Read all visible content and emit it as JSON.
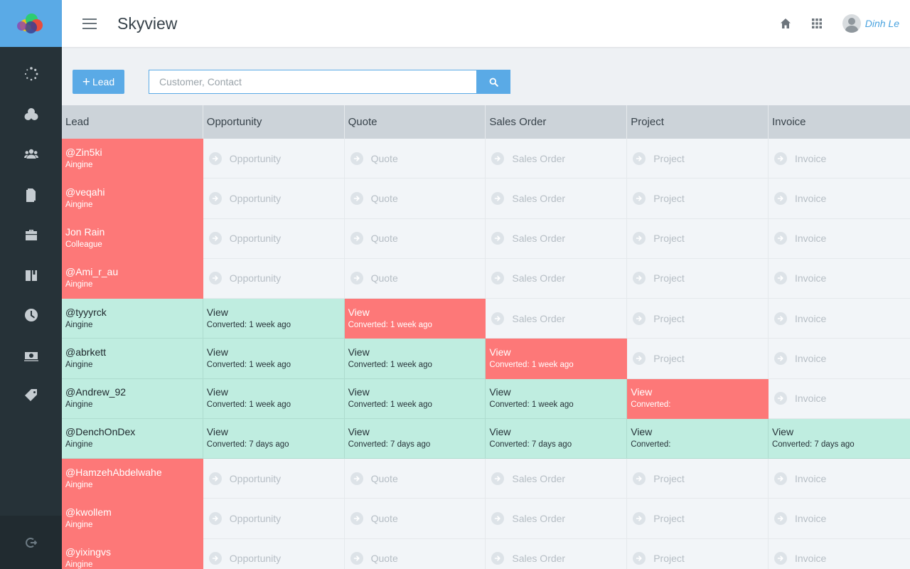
{
  "app": {
    "title": "Skyview"
  },
  "header": {
    "user_name": "Dinh Le"
  },
  "toolbar": {
    "lead_button_label": "Lead",
    "search_placeholder": "Customer, Contact"
  },
  "table": {
    "columns": [
      "Lead",
      "Opportunity",
      "Quote",
      "Sales Order",
      "Project",
      "Invoice"
    ],
    "rows": [
      {
        "lead": {
          "name": "@Zin5ki",
          "company": "Aingine"
        },
        "stages": [
          {
            "label": "Opportunity"
          },
          {
            "label": "Quote"
          },
          {
            "label": "Sales Order"
          },
          {
            "label": "Project"
          },
          {
            "label": "Invoice"
          }
        ]
      },
      {
        "lead": {
          "name": "@veqahi",
          "company": "Aingine"
        },
        "stages": [
          {
            "label": "Opportunity"
          },
          {
            "label": "Quote"
          },
          {
            "label": "Sales Order"
          },
          {
            "label": "Project"
          },
          {
            "label": "Invoice"
          }
        ]
      },
      {
        "lead": {
          "name": "Jon Rain",
          "company": "Colleague"
        },
        "stages": [
          {
            "label": "Opportunity"
          },
          {
            "label": "Quote"
          },
          {
            "label": "Sales Order"
          },
          {
            "label": "Project"
          },
          {
            "label": "Invoice"
          }
        ]
      },
      {
        "lead": {
          "name": "@Ami_r_au",
          "company": "Aingine"
        },
        "stages": [
          {
            "label": "Opportunity"
          },
          {
            "label": "Quote"
          },
          {
            "label": "Sales Order"
          },
          {
            "label": "Project"
          },
          {
            "label": "Invoice"
          }
        ]
      },
      {
        "lead": {
          "name": "@tyyyrck",
          "company": "Aingine"
        },
        "stages": [
          {
            "view": "View",
            "converted": "Converted: 1 week ago"
          },
          {
            "view": "View",
            "converted": "Converted: 1 week ago",
            "current": true
          },
          {
            "label": "Sales Order"
          },
          {
            "label": "Project"
          },
          {
            "label": "Invoice"
          }
        ]
      },
      {
        "lead": {
          "name": "@abrkett",
          "company": "Aingine"
        },
        "stages": [
          {
            "view": "View",
            "converted": "Converted: 1 week ago"
          },
          {
            "view": "View",
            "converted": "Converted: 1 week ago"
          },
          {
            "view": "View",
            "converted": "Converted: 1 week ago",
            "current": true
          },
          {
            "label": "Project"
          },
          {
            "label": "Invoice"
          }
        ]
      },
      {
        "lead": {
          "name": "@Andrew_92",
          "company": "Aingine"
        },
        "stages": [
          {
            "view": "View",
            "converted": "Converted: 1 week ago"
          },
          {
            "view": "View",
            "converted": "Converted: 1 week ago"
          },
          {
            "view": "View",
            "converted": "Converted: 1 week ago"
          },
          {
            "view": "View",
            "converted": "Converted:",
            "current": true
          },
          {
            "label": "Invoice"
          }
        ]
      },
      {
        "lead": {
          "name": "@DenchOnDex",
          "company": "Aingine"
        },
        "stages": [
          {
            "view": "View",
            "converted": "Converted: 7 days ago"
          },
          {
            "view": "View",
            "converted": "Converted: 7 days ago"
          },
          {
            "view": "View",
            "converted": "Converted: 7 days ago"
          },
          {
            "view": "View",
            "converted": "Converted:"
          },
          {
            "view": "View",
            "converted": "Converted: 7 days ago"
          }
        ]
      },
      {
        "lead": {
          "name": "@HamzehAbdelwahe",
          "company": "Aingine"
        },
        "stages": [
          {
            "label": "Opportunity"
          },
          {
            "label": "Quote"
          },
          {
            "label": "Sales Order"
          },
          {
            "label": "Project"
          },
          {
            "label": "Invoice"
          }
        ]
      },
      {
        "lead": {
          "name": "@kwollem",
          "company": "Aingine"
        },
        "stages": [
          {
            "label": "Opportunity"
          },
          {
            "label": "Quote"
          },
          {
            "label": "Sales Order"
          },
          {
            "label": "Project"
          },
          {
            "label": "Invoice"
          }
        ]
      },
      {
        "lead": {
          "name": "@yixingvs",
          "company": "Aingine"
        },
        "stages": [
          {
            "label": "Opportunity"
          },
          {
            "label": "Quote"
          },
          {
            "label": "Sales Order"
          },
          {
            "label": "Project"
          },
          {
            "label": "Invoice"
          }
        ]
      }
    ]
  },
  "colors": {
    "accent": "#5aaae6",
    "lead_pending": "#fd7878",
    "converted": "#bfede0",
    "sidebar": "#263238",
    "user_name": "#4aa3df"
  },
  "icons": {
    "sidebar": [
      "loading-dots-icon",
      "circles-icon",
      "users-icon",
      "document-icon",
      "briefcase-icon",
      "book-icon",
      "clock-icon",
      "money-icon",
      "tag-icon"
    ],
    "sidebar_bottom": "logout-icon",
    "header": [
      "home-icon",
      "apps-grid-icon"
    ],
    "stage_pending": "arrow-circle-icon",
    "search": "search-icon"
  }
}
